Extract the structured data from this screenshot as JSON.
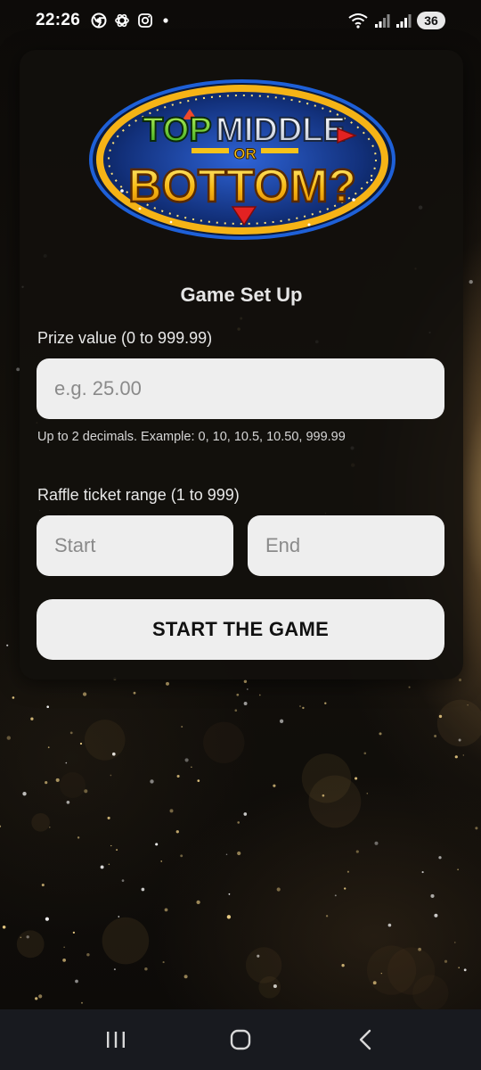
{
  "status_bar": {
    "time": "22:26",
    "notification_icons": [
      "chrome-icon",
      "openai-icon",
      "instagram-icon",
      "dot-icon"
    ],
    "right_icons": [
      "wifi-icon",
      "signal-icon",
      "signal-icon"
    ],
    "battery": "36"
  },
  "logo": {
    "line1_a": "TOP",
    "line1_b": "MIDDLE",
    "line2": "OR",
    "line3": "BOTTOM?"
  },
  "setup": {
    "title": "Game Set Up",
    "prize_label": "Prize value (0 to 999.99)",
    "prize_placeholder": "e.g. 25.00",
    "prize_value": "",
    "prize_hint": "Up to 2 decimals. Example: 0, 10, 10.5, 10.50, 999.99",
    "range_label": "Raffle ticket range (1 to 999)",
    "start_placeholder": "Start",
    "start_value": "",
    "end_placeholder": "End",
    "end_value": "",
    "start_button": "START THE GAME"
  },
  "nav": {
    "icons": [
      "recents-icon",
      "home-icon",
      "back-icon"
    ]
  },
  "colors": {
    "card_bg": "#12100d",
    "field_bg": "#eeeeee",
    "logo_yellow": "#f7c21a",
    "logo_blue": "#1c3ea8",
    "logo_red": "#e32222",
    "nav_bg": "#181a1f"
  }
}
